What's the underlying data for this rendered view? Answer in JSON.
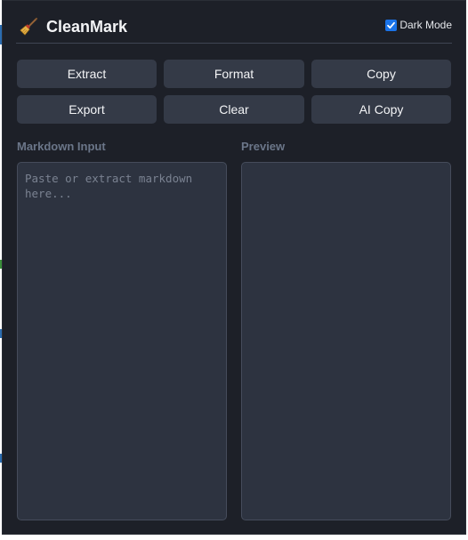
{
  "app": {
    "title": "CleanMark",
    "logo_icon": "broom-icon"
  },
  "dark_mode": {
    "label": "Dark Mode",
    "checked": true
  },
  "buttons": {
    "extract": "Extract",
    "format": "Format",
    "copy": "Copy",
    "export": "Export",
    "clear": "Clear",
    "ai_copy": "AI Copy"
  },
  "markdown_input": {
    "label": "Markdown Input",
    "placeholder": "Paste or extract markdown here...",
    "value": ""
  },
  "preview": {
    "label": "Preview",
    "content": ""
  },
  "colors": {
    "background": "#1d2028",
    "button": "#343a47",
    "panel": "#2d3340",
    "accent": "#1a73e8"
  }
}
